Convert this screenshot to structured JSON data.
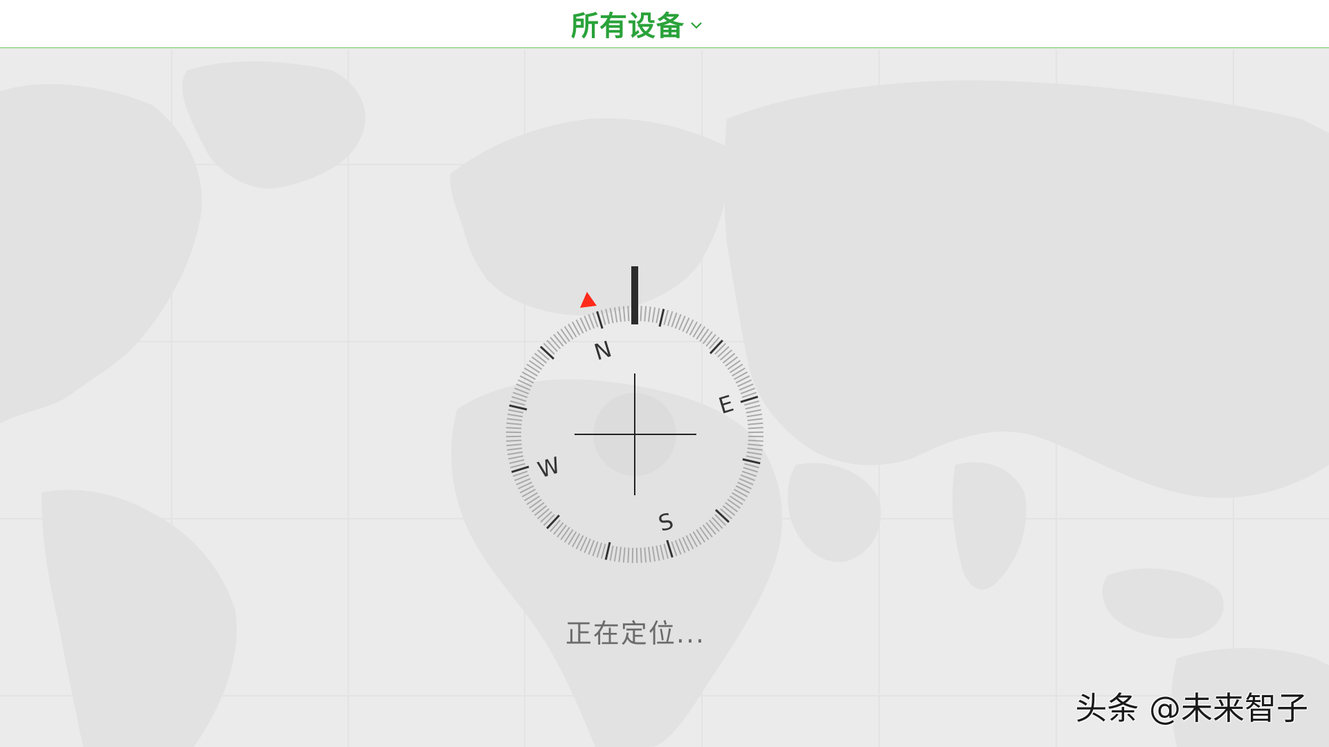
{
  "header": {
    "device_selector_label": "所有设备"
  },
  "compass": {
    "north_label": "N",
    "east_label": "E",
    "south_label": "S",
    "west_label": "W",
    "heading_marker_color": "#ff2a1a"
  },
  "status": {
    "locating_text": "正在定位..."
  },
  "watermark": {
    "text": "头条 @未来智子"
  },
  "colors": {
    "accent": "#2aa23a",
    "map_background": "#ebebeb",
    "land": "#e2e2e2"
  }
}
